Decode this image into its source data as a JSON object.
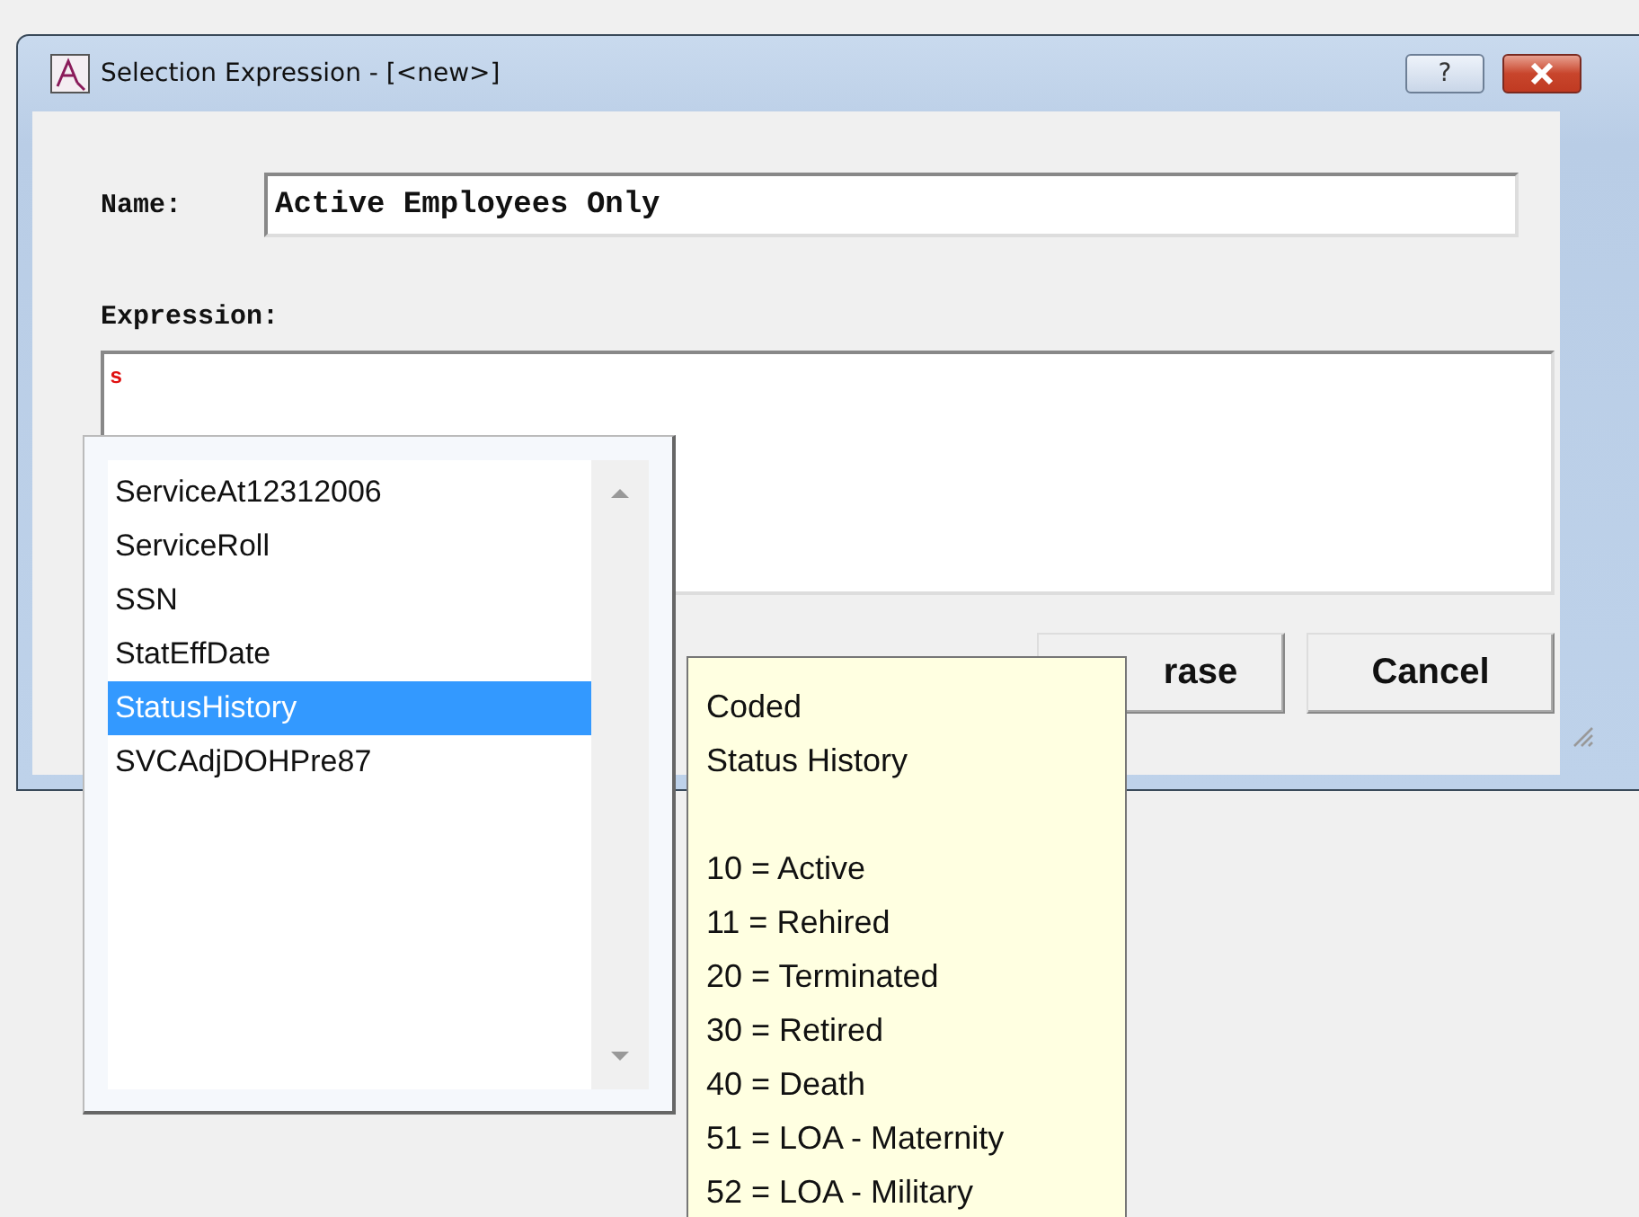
{
  "window": {
    "title": "Selection Expression - [<new>]",
    "help_button": "?"
  },
  "name": {
    "label": "Name:",
    "value": "Active Employees Only"
  },
  "expression": {
    "label": "Expression:",
    "value": "s"
  },
  "buttons": [
    {
      "label": "rase"
    },
    {
      "label": "Cancel"
    }
  ],
  "dropdown": {
    "items": [
      {
        "label": "ServiceAt12312006",
        "selected": false
      },
      {
        "label": "ServiceRoll",
        "selected": false
      },
      {
        "label": "SSN",
        "selected": false
      },
      {
        "label": "StatEffDate",
        "selected": false
      },
      {
        "label": "StatusHistory",
        "selected": true
      },
      {
        "label": "SVCAdjDOHPre87",
        "selected": false
      }
    ]
  },
  "tooltip": {
    "heading": [
      "Coded",
      "Status History"
    ],
    "codes": [
      "10 = Active",
      "11 = Rehired",
      "20 = Terminated",
      "30 = Retired",
      "40 = Death",
      "51 = LOA - Maternity",
      "52 = LOA - Military"
    ]
  }
}
